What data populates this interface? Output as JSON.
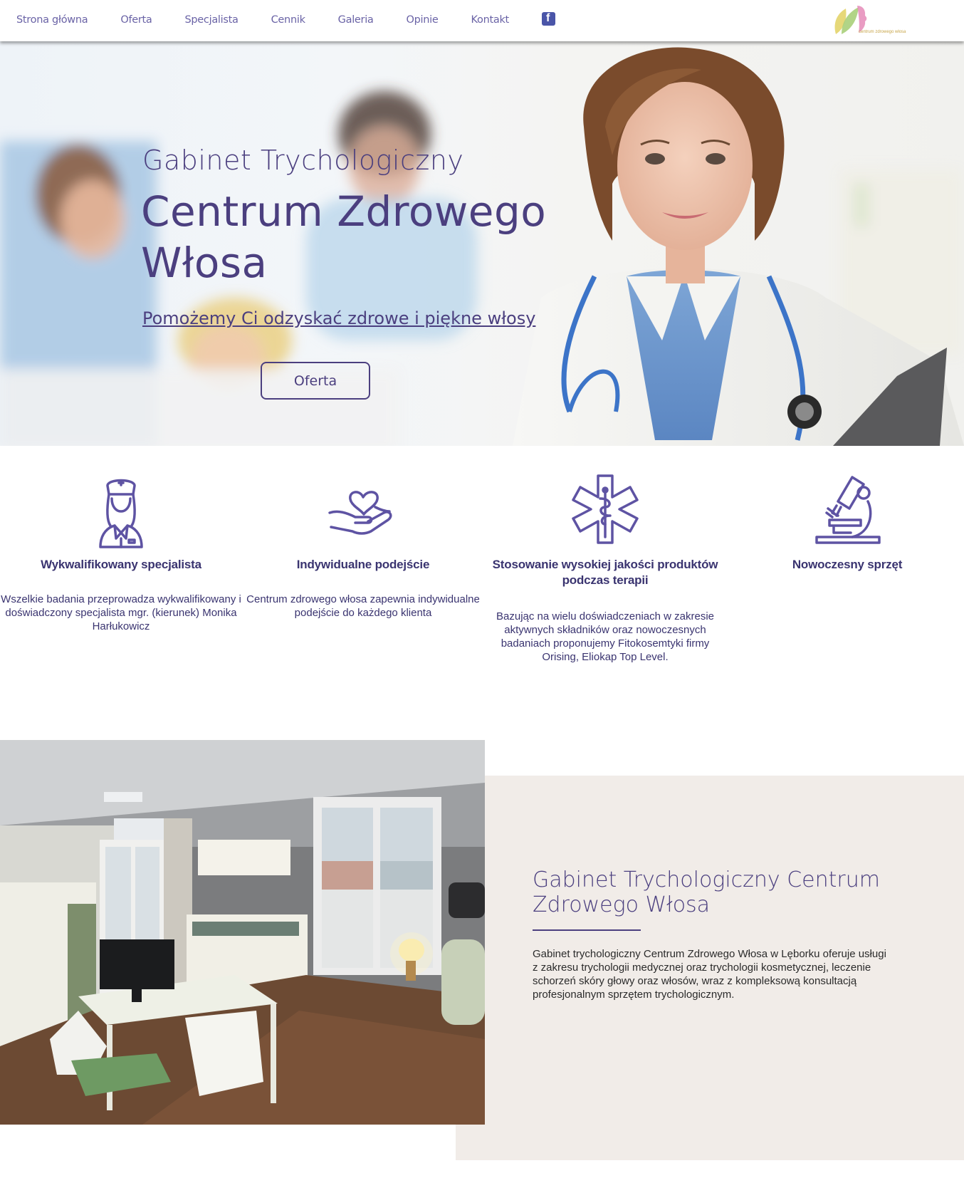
{
  "nav": {
    "items": [
      {
        "label": "Strona główna"
      },
      {
        "label": "Oferta"
      },
      {
        "label": "Specjalista"
      },
      {
        "label": "Cennik"
      },
      {
        "label": "Galeria"
      },
      {
        "label": "Opinie"
      },
      {
        "label": "Kontakt"
      }
    ],
    "facebook_glyph": "f",
    "logo_text": "centrum zdrowego włosa"
  },
  "hero": {
    "title": "Gabinet Trychologiczny",
    "heading": "Centrum Zdrowego Włosa",
    "link": "Pomożemy Ci odzyskać zdrowe i piękne włosy",
    "button": "Oferta"
  },
  "features": [
    {
      "icon": "nurse-icon",
      "title": "Wykwalifikowany specjalista",
      "text": "Wszelkie badania przeprowadza wykwalifikowany i doświadczony specjalista mgr. (kierunek) Monika Harłukowicz"
    },
    {
      "icon": "heart-hand-icon",
      "title": "Indywidualne podejście",
      "text": "Centrum zdrowego włosa zapewnia indywidualne podejście do każdego klienta"
    },
    {
      "icon": "medical-star-icon",
      "title": "Stosowanie wysokiej jakości produktów podczas terapii",
      "text": "Bazując na wielu doświadczeniach w zakresie aktywnych składników oraz nowoczesnych badaniach proponujemy Fitokosemtyki firmy Orising, Eliokap Top Level."
    },
    {
      "icon": "microscope-icon",
      "title": "Nowoczesny sprzęt",
      "text": ""
    }
  ],
  "about": {
    "title": "Gabinet Trychologiczny Centrum Zdrowego Włosa",
    "text": "Gabinet trychologiczny Centrum Zdrowego Włosa w Lęborku oferuje usługi z zakresu trychologii medycznej oraz trychologii kosmetycznej, leczenie schorzeń skóry głowy oraz włosów, wraz z kompleksową konsultacją profesjonalnym sprzętem trychologicznym."
  },
  "colors": {
    "accent": "#4b3f7f",
    "nav_text": "#6a63a6",
    "about_bg": "#f1ece8"
  }
}
